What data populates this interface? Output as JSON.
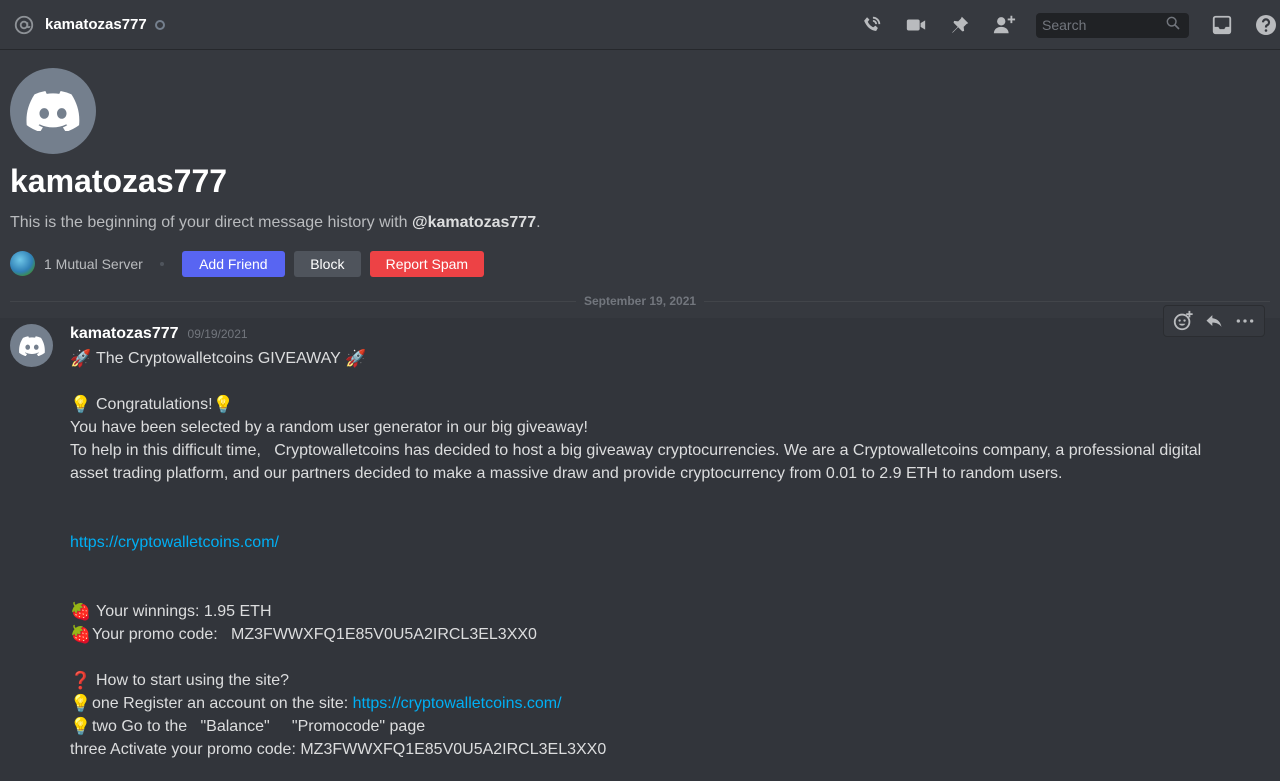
{
  "header": {
    "username": "kamatozas777",
    "search_placeholder": "Search",
    "icons": [
      "at-icon",
      "call-icon",
      "video-icon",
      "pin-icon",
      "add-member-icon",
      "search-icon",
      "inbox-icon",
      "help-icon"
    ]
  },
  "intro": {
    "name": "kamatozas777",
    "description_prefix": "This is the beginning of your direct message history with",
    "description_handle": "@kamatozas777",
    "description_suffix": ".",
    "mutual_servers": "1 Mutual Server",
    "add_friend_label": "Add Friend",
    "block_label": "Block",
    "report_spam_label": "Report Spam"
  },
  "divider_date": "September 19, 2021",
  "message": {
    "author": "kamatozas777",
    "timestamp": "09/19/2021",
    "title": "The Cryptowalletcoins GIVEAWAY",
    "congrats": "Congratulations!",
    "line_selected": "You have been selected by a random user generator in our big giveaway!",
    "paragraph": "To help in this difficult time,   Cryptowalletcoins has decided to host a big giveaway cryptocurrencies. We are a Cryptowalletcoins company, a professional digital asset trading platform, and our partners decided to make a massive draw and provide cryptocurrency from 0.01 to 2.9 ETH to random users.",
    "link": "https://cryptowalletcoins.com/",
    "winnings": "Your winnings: 1.95 ETH",
    "promo": "Your promo code:   MZ3FWWXFQ1E85V0U5A2IRCL3EL3XX0",
    "how_to": "How to start using the site?",
    "step_one_prefix": "one Register an account on the site: ",
    "step_one_link": "https://cryptowalletcoins.com/",
    "step_two": "two Go to the   \"Balance\"     \"Promocode\" page",
    "step_three": "three Activate your promo code: MZ3FWWXFQ1E85V0U5A2IRCL3EL3XX0"
  },
  "colors": {
    "background": "#36393f",
    "message_hover": "#32353b",
    "blurple": "#5865f2",
    "danger": "#ed4245",
    "link": "#00aff4"
  }
}
